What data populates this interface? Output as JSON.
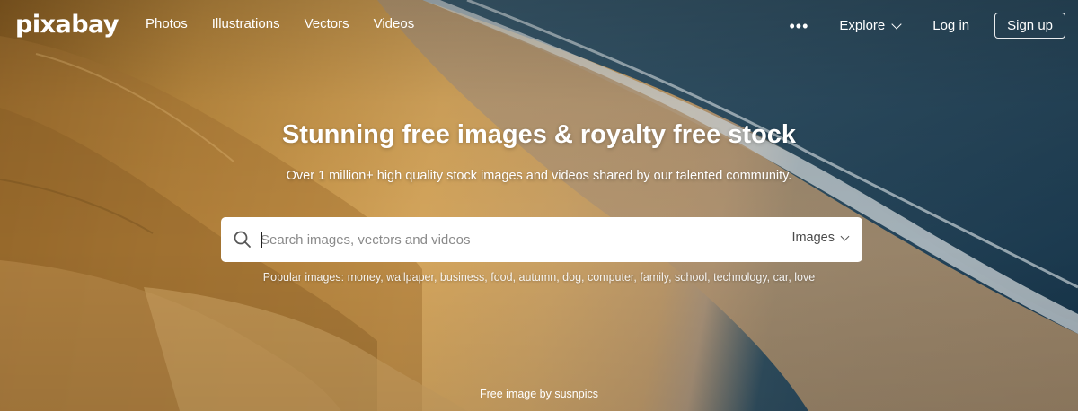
{
  "brand": {
    "logo_text": "pixabay"
  },
  "nav": {
    "links": [
      "Photos",
      "Illustrations",
      "Vectors",
      "Videos"
    ],
    "more_icon": "more-dots-icon",
    "explore_label": "Explore",
    "login_label": "Log in",
    "signup_label": "Sign up"
  },
  "hero": {
    "headline": "Stunning free images & royalty free stock",
    "subline": "Over 1 million+ high quality stock images and videos shared by our talented community.",
    "credit": "Free image by susnpics"
  },
  "search": {
    "placeholder": "Search images, vectors and videos",
    "value": "",
    "type_selected": "Images",
    "icon": "search-icon"
  },
  "popular": {
    "prefix": "Popular images:",
    "tags": [
      "money",
      "wallpaper",
      "business",
      "food",
      "autumn",
      "dog",
      "computer",
      "family",
      "school",
      "technology",
      "car",
      "love"
    ]
  },
  "colors": {
    "sand": "#c9984d",
    "sea": "#1d3c52",
    "text": "#ffffff"
  }
}
